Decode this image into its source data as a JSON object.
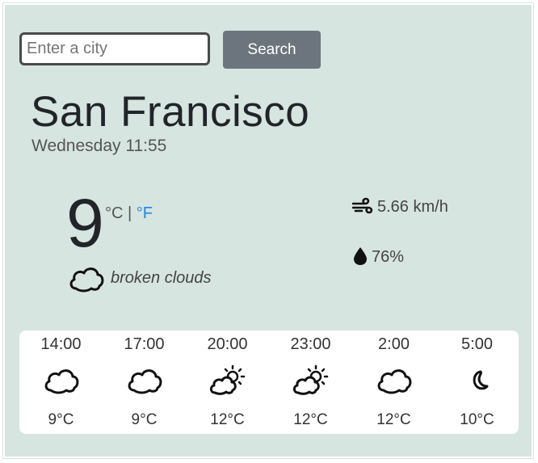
{
  "search": {
    "placeholder": "Enter a city",
    "button_label": "Search"
  },
  "current": {
    "city": "San Francisco",
    "datetime": "Wednesday 11:55",
    "temperature": "9",
    "unit_c": "°C",
    "unit_separator": "|",
    "unit_f": "°F",
    "description": "broken clouds",
    "description_icon": "cloud-icon",
    "wind": "5.66 km/h",
    "wind_icon": "wind-icon",
    "humidity": "76%",
    "humidity_icon": "droplet-icon"
  },
  "forecast": [
    {
      "time": "14:00",
      "temp": "9°C",
      "icon": "cloud-icon"
    },
    {
      "time": "17:00",
      "temp": "9°C",
      "icon": "cloud-icon"
    },
    {
      "time": "20:00",
      "temp": "12°C",
      "icon": "sun-cloud-icon"
    },
    {
      "time": "23:00",
      "temp": "12°C",
      "icon": "sun-cloud-icon"
    },
    {
      "time": "2:00",
      "temp": "12°C",
      "icon": "cloud-icon"
    },
    {
      "time": "5:00",
      "temp": "10°C",
      "icon": "moon-icon"
    }
  ],
  "colors": {
    "background": "#d6e5df",
    "button": "#6c757d",
    "unit_link": "#1e88e5",
    "card": "#ffffff"
  }
}
